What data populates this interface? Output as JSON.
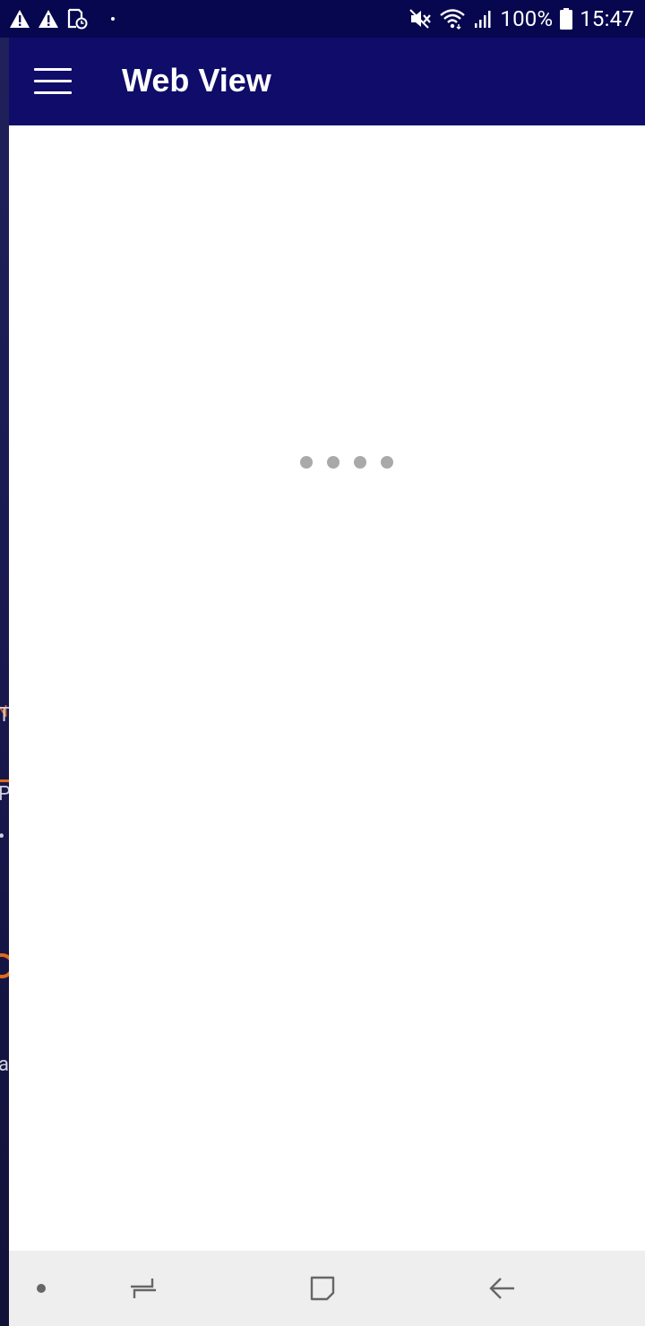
{
  "status_bar": {
    "battery_text": "100%",
    "time": "15:47",
    "left_icons": [
      "warning-icon",
      "warning-icon",
      "screenshot-icon",
      "dot-indicator"
    ],
    "right_icons": [
      "mute-vibrate-icon",
      "wifi-icon",
      "signal-icon",
      "battery-icon"
    ]
  },
  "app_bar": {
    "title": "Web View",
    "menu_icon": "hamburger-menu-icon"
  },
  "content": {
    "loading_dots": 4
  },
  "nav_bar": {
    "items": [
      "dot-indicator",
      "recent-apps-icon",
      "home-icon",
      "back-icon"
    ]
  },
  "colors": {
    "status_bar": "#07074f",
    "app_bar": "#0f0c6a",
    "loader_dot": "#a9a9a9",
    "nav_bar": "#eeeeee",
    "accent_orange": "#e06a1a"
  }
}
